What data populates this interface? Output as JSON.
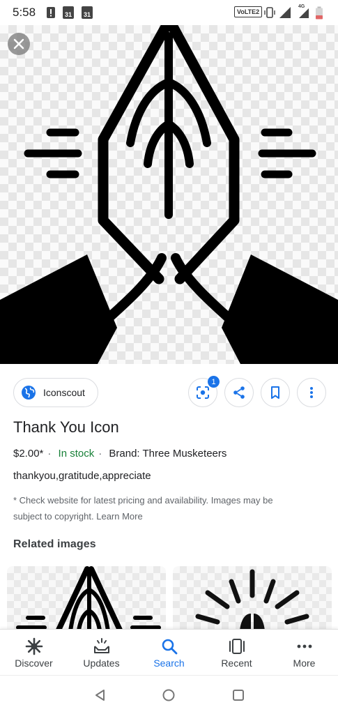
{
  "status_bar": {
    "time": "5:58",
    "calendar_day_1": "31",
    "calendar_day_2": "31",
    "volte": "VoLTE2",
    "network": "4G"
  },
  "viewer": {
    "source": {
      "name": "Iconscout"
    },
    "lens_badge_count": "1",
    "title": "Thank You Icon",
    "price": "$2.00*",
    "stock": "In stock",
    "brand": "Brand: Three Musketeers",
    "tags": "thankyou,gratitude,appreciate",
    "disclaimer": "* Check website for pricing and availability. Images may be subject to copyright. Learn More",
    "disclaimer_line1": "* Check website for latest pricing and availability. Images may be",
    "disclaimer_line2": "subject to copyright. Learn More",
    "related_title": "Related images"
  },
  "bottom_nav": [
    {
      "label": "Discover",
      "icon": "discover-icon"
    },
    {
      "label": "Updates",
      "icon": "updates-icon"
    },
    {
      "label": "Search",
      "icon": "search-icon",
      "active": true
    },
    {
      "label": "Recent",
      "icon": "recent-icon"
    },
    {
      "label": "More",
      "icon": "more-dots-icon"
    }
  ],
  "colors": {
    "accent": "#1a73e8",
    "in_stock": "#188038",
    "text": "#202124",
    "secondary_text": "#5f6368"
  }
}
